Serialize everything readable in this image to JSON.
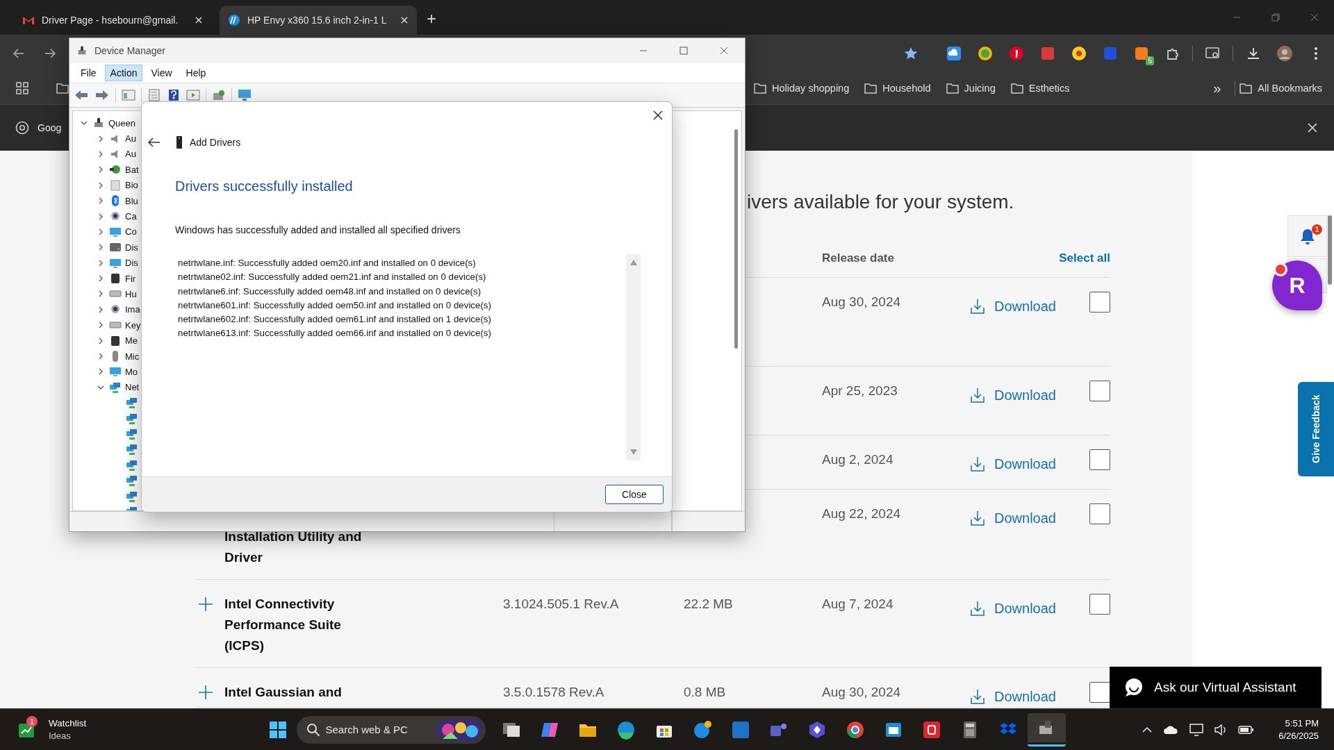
{
  "browser": {
    "tabs": [
      {
        "title": "Driver Page - hsebourn@gmail.",
        "selected": false
      },
      {
        "title": "HP Envy x360 15.6 inch 2-in-1 L",
        "selected": true
      }
    ],
    "new_tab": "+",
    "extension_badge": "5",
    "bookmarks": [
      "Holiday shopping",
      "Household",
      "Juicing",
      "Esthetics"
    ],
    "more_bookmarks": "»",
    "all_bookmarks": "All Bookmarks",
    "infobar_text": "Goog"
  },
  "page": {
    "heading": "ivers available for your system.",
    "columns": {
      "release_date": "Release date",
      "select_all": "Select all"
    },
    "rows": [
      {
        "date": "Aug 30, 2024",
        "download": "Download",
        "checked": false
      },
      {
        "date": "Apr 25, 2023",
        "download": "Download",
        "checked": false
      },
      {
        "date": "Aug 2, 2024",
        "download": "Download",
        "checked": false
      },
      {
        "name": "Installation Utility and Driver",
        "date": "Aug 22, 2024",
        "download": "Download",
        "checked": false
      },
      {
        "name": "Intel Connectivity Performance Suite (ICPS)",
        "version": "3.1024.505.1 Rev.A",
        "size": "22.2 MB",
        "date": "Aug 7, 2024",
        "download": "Download",
        "checked": false
      },
      {
        "name": "Intel Gaussian and",
        "version": "3.5.0.1578 Rev.A",
        "size": "0.8 MB",
        "date": "Aug 30, 2024",
        "download": "Download",
        "checked": false
      }
    ],
    "notification_count": "1",
    "floating_button": "R",
    "feedback": "Give Feedback",
    "assistant": "Ask our Virtual Assistant"
  },
  "device_manager": {
    "title": "Device Manager",
    "menu": [
      {
        "label": "File",
        "selected": false
      },
      {
        "label": "Action",
        "selected": true
      },
      {
        "label": "View",
        "selected": false
      },
      {
        "label": "Help",
        "selected": false
      }
    ],
    "tree": {
      "label": "Queen",
      "kind": "computer",
      "expanded": true,
      "children": [
        {
          "label": "Au",
          "kind": "speaker",
          "expanded": false
        },
        {
          "label": "Au",
          "kind": "speaker",
          "expanded": false
        },
        {
          "label": "Bat",
          "kind": "battery",
          "expanded": false
        },
        {
          "label": "Bio",
          "kind": "fingerprint",
          "expanded": false
        },
        {
          "label": "Blu",
          "kind": "bluetooth",
          "expanded": false
        },
        {
          "label": "Ca",
          "kind": "camera",
          "expanded": false
        },
        {
          "label": "Co",
          "kind": "monitor",
          "expanded": false
        },
        {
          "label": "Dis",
          "kind": "disk",
          "expanded": false
        },
        {
          "label": "Dis",
          "kind": "monitor",
          "expanded": false
        },
        {
          "label": "Fir",
          "kind": "chip",
          "expanded": false
        },
        {
          "label": "Hu",
          "kind": "keyboard",
          "expanded": false
        },
        {
          "label": "Ima",
          "kind": "camera",
          "expanded": false
        },
        {
          "label": "Key",
          "kind": "keyboard",
          "expanded": false
        },
        {
          "label": "Me",
          "kind": "chip",
          "expanded": false
        },
        {
          "label": "Mic",
          "kind": "mouse",
          "expanded": false
        },
        {
          "label": "Mo",
          "kind": "monitor",
          "expanded": false
        },
        {
          "label": "Net",
          "kind": "network",
          "expanded": true,
          "children": [
            {
              "kind": "network"
            },
            {
              "kind": "network"
            },
            {
              "kind": "network"
            },
            {
              "kind": "network"
            },
            {
              "kind": "network"
            },
            {
              "kind": "network"
            },
            {
              "kind": "network"
            },
            {
              "kind": "network"
            }
          ]
        }
      ]
    }
  },
  "dialog": {
    "title": "Add Drivers",
    "heading": "Drivers successfully installed",
    "message": "Windows has successfully added and installed all specified drivers",
    "results": [
      "netrtwlane.inf: Successfully added oem20.inf and installed on 0 device(s)",
      "netrtwlane02.inf: Successfully added oem21.inf and installed on 0 device(s)",
      "netrtwlane6.inf: Successfully added oem48.inf and installed on 0 device(s)",
      "netrtwlane601.inf: Successfully added oem50.inf and installed on 0 device(s)",
      "netrtwlane602.inf: Successfully added oem61.inf and installed on 1 device(s)",
      "netrtwlane613.inf: Successfully added oem66.inf and installed on 0 device(s)"
    ],
    "close_button": "Close"
  },
  "taskbar": {
    "widget": {
      "badge": "1",
      "title": "Watchlist",
      "subtitle": "Ideas"
    },
    "search": {
      "placeholder": "Search web & PC"
    },
    "apps": [
      {
        "kind": "taskview",
        "selected": false
      },
      {
        "kind": "copilot",
        "selected": false
      },
      {
        "kind": "folder",
        "selected": false
      },
      {
        "kind": "edge",
        "selected": false
      },
      {
        "kind": "store",
        "selected": false
      },
      {
        "kind": "help",
        "selected": false
      },
      {
        "kind": "hp",
        "selected": false
      },
      {
        "kind": "teams",
        "selected": false
      },
      {
        "kind": "hex",
        "selected": false
      },
      {
        "kind": "chrome",
        "selected": false
      },
      {
        "kind": "calendar",
        "selected": false
      },
      {
        "kind": "acrobat",
        "selected": false
      },
      {
        "kind": "calculator",
        "selected": false
      },
      {
        "kind": "dropbox",
        "selected": false
      },
      {
        "kind": "devmgr",
        "selected": true
      }
    ],
    "clock": {
      "time": "5:51 PM",
      "date": "6/26/2025"
    }
  }
}
